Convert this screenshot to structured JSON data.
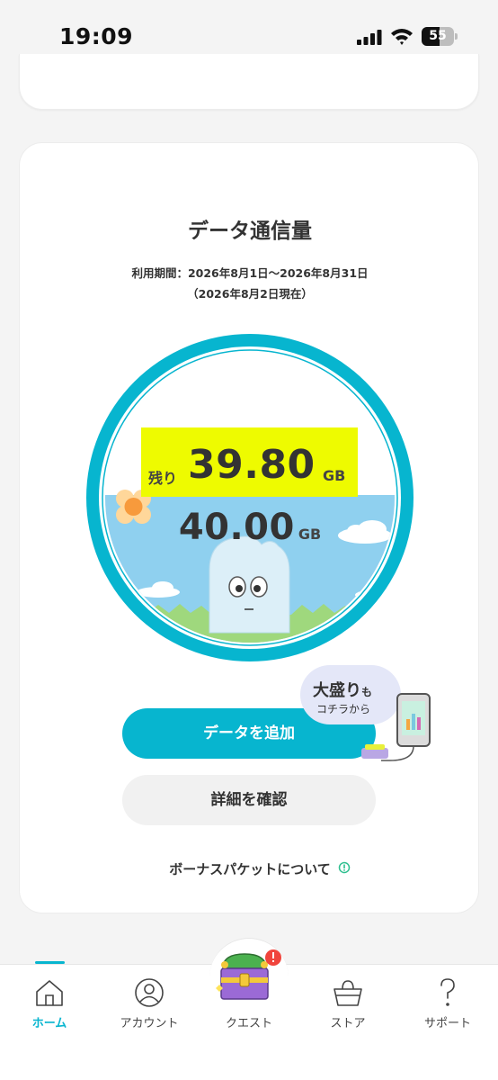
{
  "status_bar": {
    "time": "19:09",
    "battery": "55",
    "battery_level": 0.55
  },
  "data_card": {
    "title": "データ通信量",
    "period": "利用期間：2026年8月1日〜2026年8月31日",
    "as_of": "（2026年8月2日現在）",
    "remaining_label": "残り",
    "remaining_value": "39.80",
    "remaining_unit": "GB",
    "total_value": "40.00",
    "total_unit": "GB",
    "add_data_button": "データを追加",
    "details_button": "詳細を確認",
    "bonus_link": "ボーナスパケットについて",
    "promo": {
      "line1_main": "大盛り",
      "line1_small": "も",
      "line2": "コチラから"
    }
  },
  "colors": {
    "accent": "#07b5cf",
    "highlight": "#eefb00",
    "sky": "#8fd0ef",
    "grass": "#9fd87d"
  },
  "tab_bar": {
    "tabs": [
      {
        "label": "ホーム",
        "icon": "home-icon",
        "active": true
      },
      {
        "label": "アカウント",
        "icon": "account-icon",
        "active": false
      },
      {
        "label": "クエスト",
        "icon": "treasure-chest-icon",
        "active": false
      },
      {
        "label": "ストア",
        "icon": "basket-icon",
        "active": false
      },
      {
        "label": "サポート",
        "icon": "question-icon",
        "active": false
      }
    ]
  }
}
